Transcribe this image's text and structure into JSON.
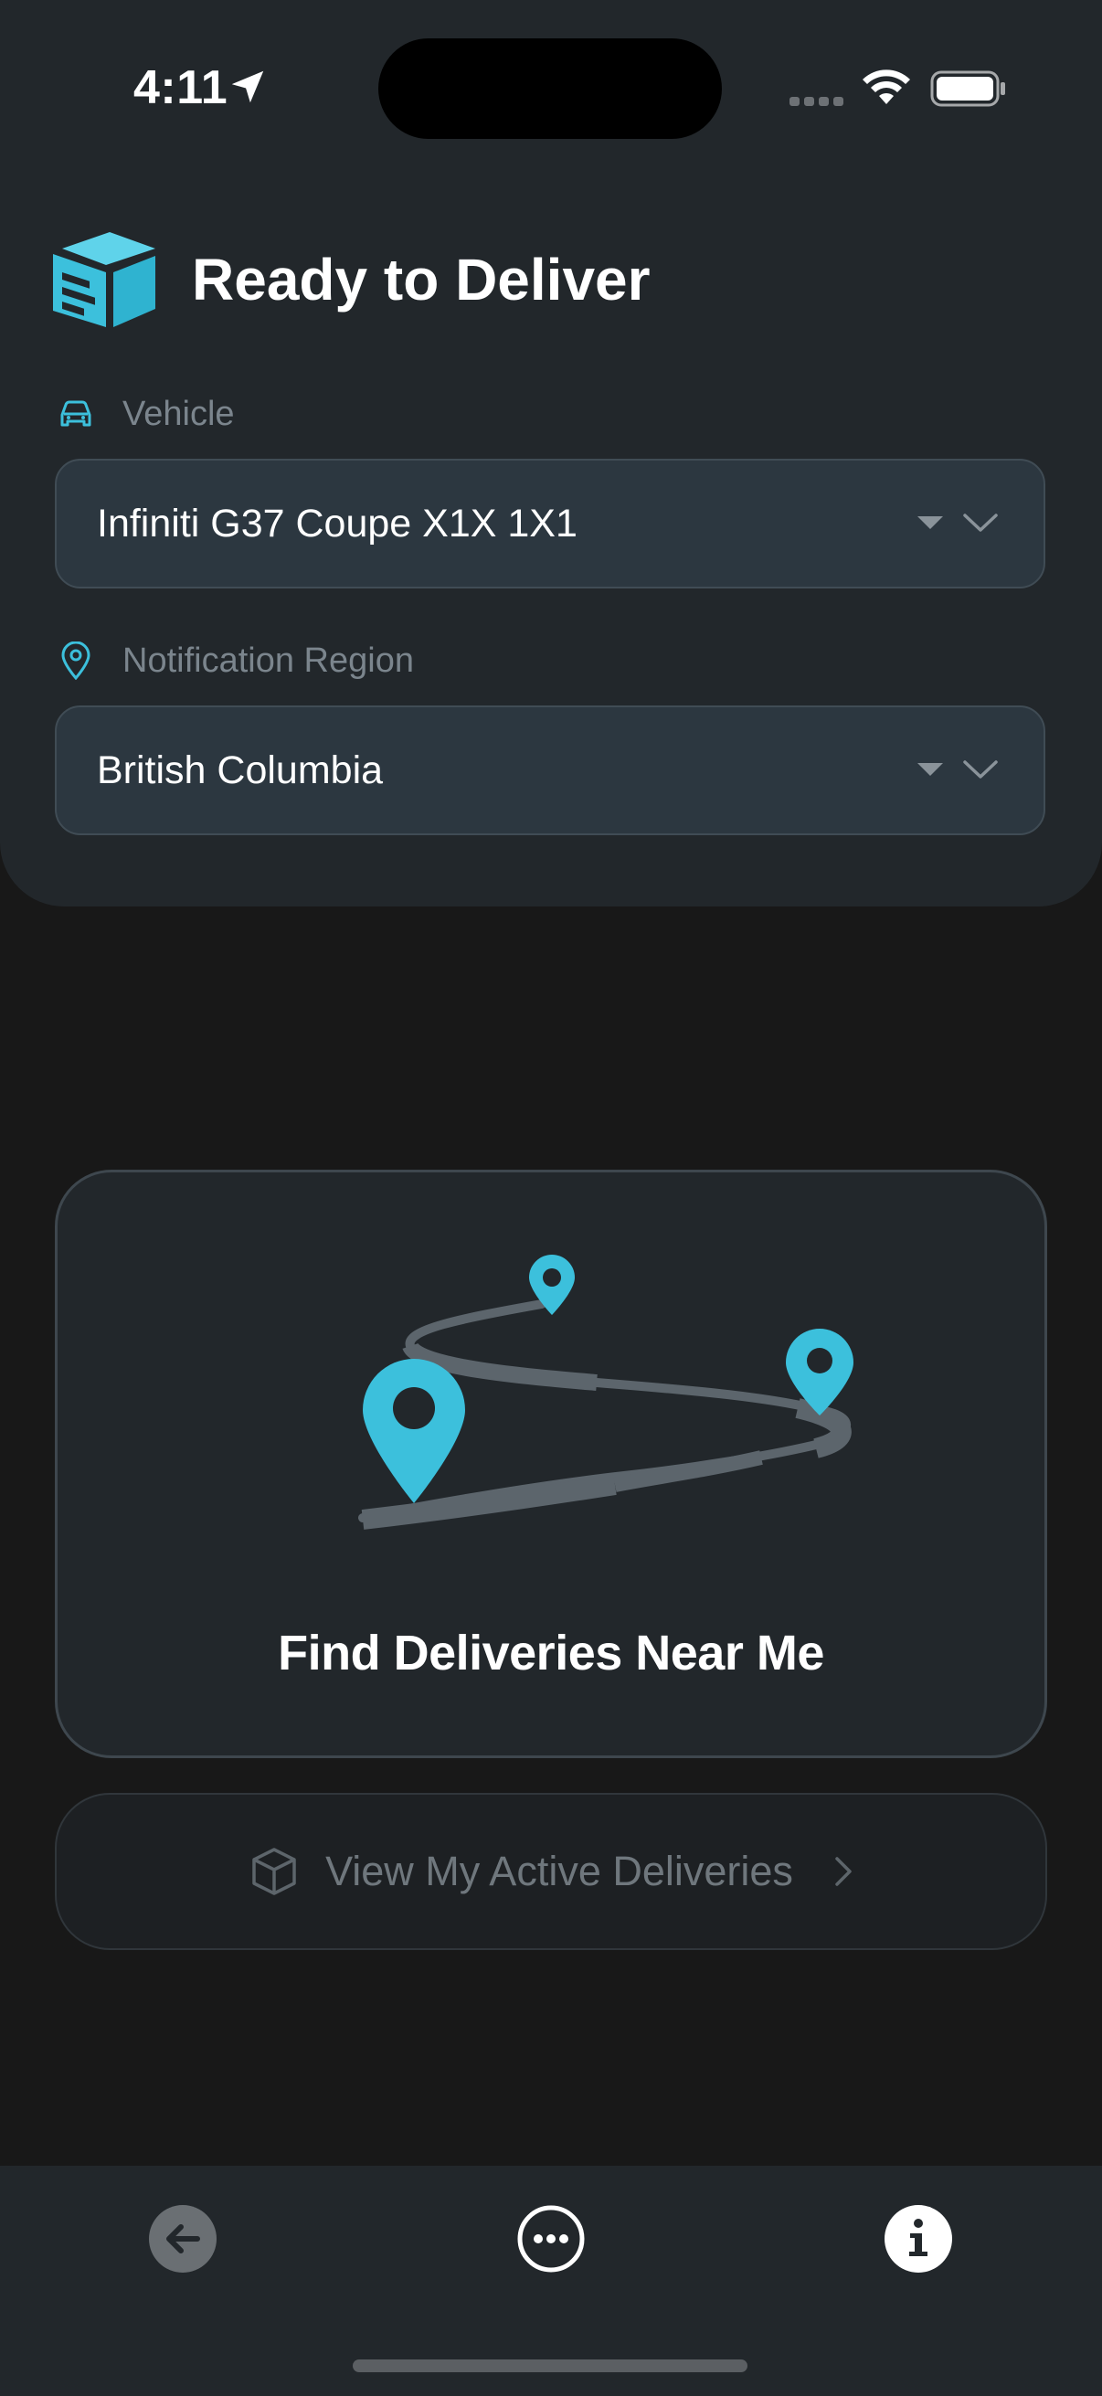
{
  "status_bar": {
    "time": "4:11"
  },
  "header": {
    "title": "Ready to Deliver",
    "logo_icon": "delivery-box-logo-icon"
  },
  "vehicle": {
    "label": "Vehicle",
    "icon": "car-icon",
    "value": "Infiniti G37 Coupe X1X 1X1"
  },
  "region": {
    "label": "Notification Region",
    "icon": "map-pin-icon",
    "value": "British Columbia"
  },
  "find_card": {
    "label": "Find Deliveries Near Me"
  },
  "active_deliveries": {
    "label": "View My Active Deliveries",
    "icon": "package-icon"
  },
  "toolbar": {
    "back_icon": "back-arrow-icon",
    "more_icon": "more-options-icon",
    "info_icon": "info-icon"
  },
  "colors": {
    "accent": "#3cc0dc",
    "panel": "#22272b",
    "background": "#181818",
    "select_fill": "#2c3740",
    "muted_text": "#7b858d"
  }
}
